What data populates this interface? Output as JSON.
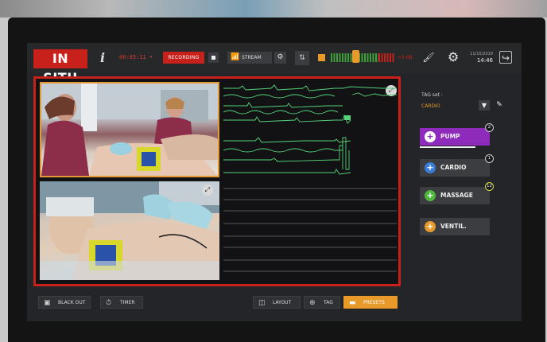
{
  "header": {
    "logo": "IN SITU",
    "info_glyph": "i",
    "timecode": "00:05:11 •",
    "record_label": "RECORDING",
    "stream_label": "STREAM",
    "vu_db": "+3 dB",
    "date": "11/10/2019",
    "time": "14:46"
  },
  "tagset": {
    "label": "TAG set :",
    "value": "CARDIO"
  },
  "tags": [
    {
      "label": "PUMP",
      "color": "#8e2bbd",
      "badge": "2",
      "progress": 0.8
    },
    {
      "label": "CARDIO",
      "color": "#3a7cd6",
      "badge": "1"
    },
    {
      "label": "MASSAGE",
      "color": "#4fb53c",
      "badge": "12"
    },
    {
      "label": "VENTIL.",
      "color": "#e79a2a",
      "badge": ""
    }
  ],
  "bottom": {
    "blackout_label": "BLACK OUT",
    "timer_label": "TIMER",
    "layout_label": "LAYOUT",
    "tag_label": "TAG",
    "presets_label": "PRESETS"
  },
  "icons": {
    "stream": "stream-icon",
    "settings": "gear-icon",
    "exit": "exit-icon",
    "mixer": "mixer-icon",
    "brush": "brush-icon"
  },
  "colors": {
    "accent_red": "#c8201b",
    "accent_orange": "#e79a2a",
    "wave_green": "#55d27a"
  }
}
